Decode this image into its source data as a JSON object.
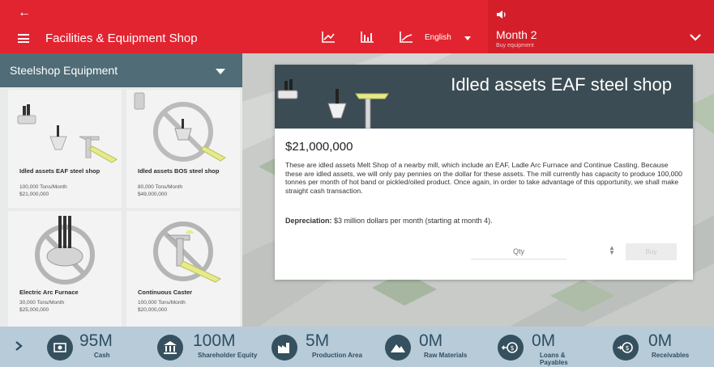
{
  "header": {
    "title": "Facilities & Equipment Shop",
    "language": "English",
    "month_title": "Month 2",
    "month_subtitle": "Buy equipment"
  },
  "left_panel": {
    "category": "Steelshop Equipment",
    "cards": [
      {
        "name": "Idled assets EAF steel shop",
        "capacity": "100,000 Tons/Month",
        "price": "$21,000,000"
      },
      {
        "name": "Idled assets BOS steel shop",
        "capacity": "80,000 Tons/Month",
        "price": "$49,000,000"
      },
      {
        "name": "Electric Arc Furnace",
        "capacity": "30,000 Tons/Month",
        "price": "$25,000,000"
      },
      {
        "name": "Continuous Caster",
        "capacity": "100,000 Tons/Month",
        "price": "$20,000,000"
      }
    ]
  },
  "detail": {
    "title": "Idled assets EAF steel shop",
    "price": "$21,000,000",
    "description": "These are idled assets Melt Shop of a nearby mill, which include an EAF, Ladle Arc Furnace and Continue Casting. Because these are idled assets, we will only pay pennies on the dollar for these assets. The mill currently has capacity to produce 100,000 tonnes per month of hot band or pickled/oiled product. Once again, in order to take advantage of this opportunity, we shall make straight cash transaction.",
    "depreciation_label": "Depreciation:",
    "depreciation_text": " $3 million dollars per month (starting at month 4).",
    "qty_placeholder": "Qty",
    "buy_label": "Buy"
  },
  "stats": [
    {
      "value": "95M",
      "label": "Cash",
      "icon": "cash-icon"
    },
    {
      "value": "100M",
      "label": "Shareholder Equity",
      "icon": "bank-icon"
    },
    {
      "value": "5M",
      "label": "Production Area",
      "icon": "factory-icon"
    },
    {
      "value": "0M",
      "label": "Raw Materials",
      "icon": "mountain-icon"
    },
    {
      "value": "0M",
      "label": "Loans & Payables",
      "icon": "loan-icon"
    },
    {
      "value": "0M",
      "label": "Receivables",
      "icon": "receivable-icon"
    }
  ],
  "colors": {
    "header_red": "#e22430",
    "category_bar": "#4f6c77",
    "detail_header": "#3b4c54",
    "bottom_bar": "#b8cbd9",
    "stat_text": "#2e4f62"
  }
}
